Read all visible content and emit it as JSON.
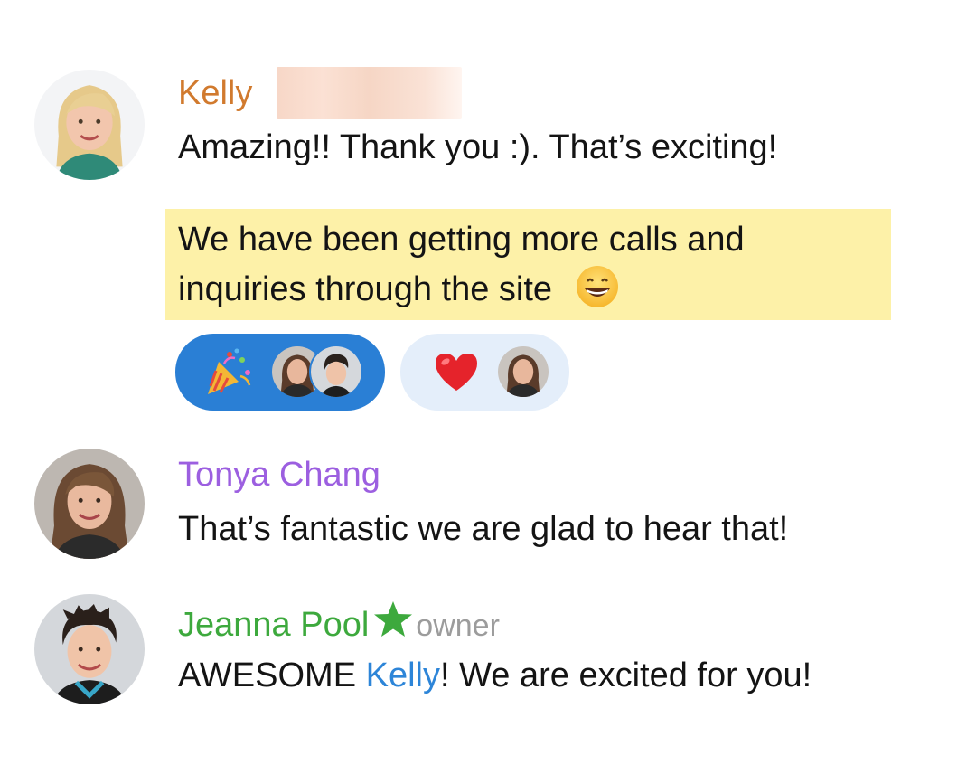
{
  "messages": [
    {
      "author": "Kelly",
      "author_color": "#d17a2e",
      "avatar": "avatar-kelly",
      "lines": [
        "Amazing!! Thank you :). That’s exciting!"
      ],
      "highlighted_lines": [
        "We have been getting more calls and",
        "inquiries through the site"
      ],
      "highlight_color": "#fdf1a8",
      "highlight_emoji": "grinning-face-icon",
      "reactions": [
        {
          "emoji": "party-popper-icon",
          "active": true,
          "users": [
            "avatar-tonya",
            "avatar-jeanna"
          ],
          "color": "#2a7fd5"
        },
        {
          "emoji": "red-heart-icon",
          "active": false,
          "users": [
            "avatar-tonya"
          ],
          "color": "#e4eefa"
        }
      ]
    },
    {
      "author": "Tonya Chang",
      "author_color": "#9c5fe0",
      "avatar": "avatar-tonya",
      "lines": [
        "That’s fantastic we are glad to hear that!"
      ]
    },
    {
      "author": "Jeanna Pool",
      "author_color": "#3da93d",
      "avatar": "avatar-jeanna",
      "role_icon": "star-icon",
      "role_label": "owner",
      "text_before": "AWESOME ",
      "mention": "Kelly",
      "mention_color": "#2d85d8",
      "text_after": "! We are excited for you!"
    }
  ]
}
